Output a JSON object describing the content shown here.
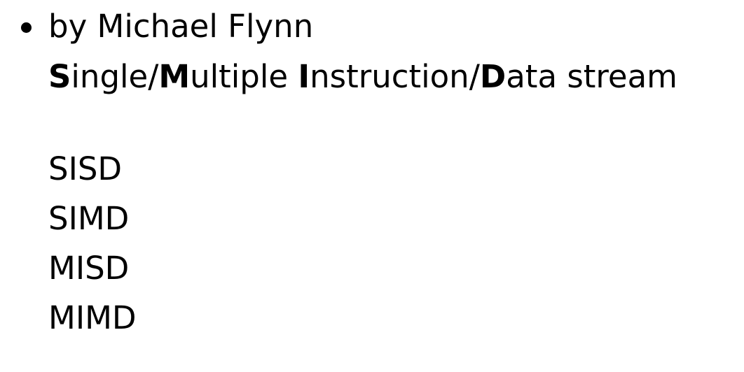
{
  "bullet": {
    "text": "by Michael Flynn"
  },
  "expansion": {
    "parts": [
      {
        "bold": "S",
        "rest": "ingle/"
      },
      {
        "bold": "M",
        "rest": "ultiple "
      },
      {
        "bold": "I",
        "rest": "nstruction/"
      },
      {
        "bold": "D",
        "rest": "ata stream"
      }
    ]
  },
  "acronyms": [
    "SISD",
    "SIMD",
    "MISD",
    "MIMD"
  ]
}
